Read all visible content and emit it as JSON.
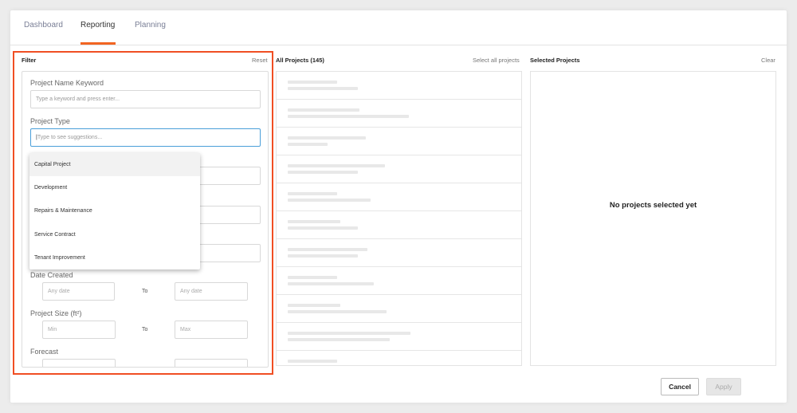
{
  "tabs": [
    {
      "label": "Dashboard"
    },
    {
      "label": "Reporting"
    },
    {
      "label": "Planning"
    }
  ],
  "filter": {
    "title": "Filter",
    "reset": "Reset",
    "keyword_label": "Project Name Keyword",
    "keyword_placeholder": "Type a keyword and press enter...",
    "type_label": "Project Type",
    "type_placeholder": "Type to see suggestions...",
    "date_label": "Date Created",
    "date_from_placeholder": "Any date",
    "date_to_placeholder": "Any date",
    "to_label": "To",
    "size_label": "Project Size (ft²)",
    "size_min_placeholder": "Min",
    "size_max_placeholder": "Max",
    "forecast_label": "Forecast"
  },
  "dropdown": {
    "options": [
      "Capital Project",
      "Development",
      "Repairs & Maintenance",
      "Service Contract",
      "Tenant Improvement"
    ],
    "highlighted_index": 0
  },
  "all_projects": {
    "title": "All Projects (145)",
    "select_all": "Select all projects"
  },
  "selected_projects": {
    "title": "Selected Projects",
    "clear": "Clear",
    "empty_message": "No projects selected yet"
  },
  "actions": {
    "cancel": "Cancel",
    "apply": "Apply"
  },
  "colors": {
    "accent": "#f26522",
    "highlight_border": "#f04e23",
    "focus": "#4a9fd9"
  }
}
